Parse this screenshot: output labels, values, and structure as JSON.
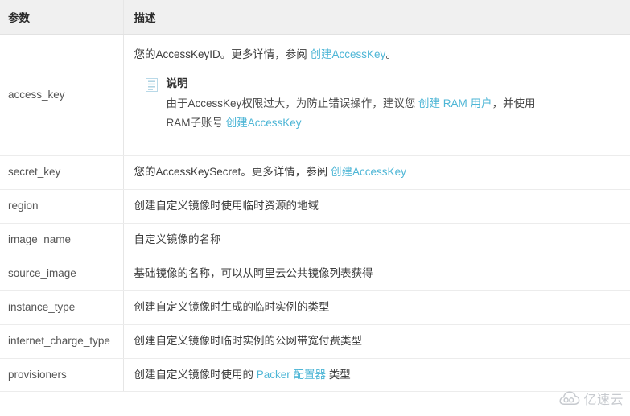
{
  "table": {
    "headers": {
      "param": "参数",
      "desc": "描述"
    },
    "link_color": "#4eb6d6",
    "header_bg": "#f0f0f0",
    "rows": [
      {
        "param": "access_key",
        "desc_prefix": "您的AccessKeyID。更多详情，参阅 ",
        "desc_link": "创建AccessKey",
        "desc_suffix": "。",
        "note": {
          "icon": "note-document-icon",
          "title": "说明",
          "text_1": "由于AccessKey权限过大，为防止错误操作，建议您 ",
          "link_1": "创建 RAM 用户",
          "text_2": "，并使用RAM子账号 ",
          "link_2": "创建AccessKey"
        }
      },
      {
        "param": "secret_key",
        "desc_prefix": "您的AccessKeySecret。更多详情，参阅 ",
        "desc_link": "创建AccessKey",
        "desc_suffix": ""
      },
      {
        "param": "region",
        "desc_prefix": "创建自定义镜像时使用临时资源的地域",
        "desc_link": "",
        "desc_suffix": ""
      },
      {
        "param": "image_name",
        "desc_prefix": "自定义镜像的名称",
        "desc_link": "",
        "desc_suffix": ""
      },
      {
        "param": "source_image",
        "desc_prefix": "基础镜像的名称，可以从阿里云公共镜像列表获得",
        "desc_link": "",
        "desc_suffix": ""
      },
      {
        "param": "instance_type",
        "desc_prefix": "创建自定义镜像时生成的临时实例的类型",
        "desc_link": "",
        "desc_suffix": ""
      },
      {
        "param": "internet_charge_type",
        "desc_prefix": "创建自定义镜像时临时实例的公网带宽付费类型",
        "desc_link": "",
        "desc_suffix": ""
      },
      {
        "param": "provisioners",
        "desc_prefix": "创建自定义镜像时使用的 ",
        "desc_link": "Packer 配置器",
        "desc_suffix": " 类型"
      }
    ]
  },
  "watermark": {
    "icon": "cloud-logo-icon",
    "text": "亿速云"
  }
}
